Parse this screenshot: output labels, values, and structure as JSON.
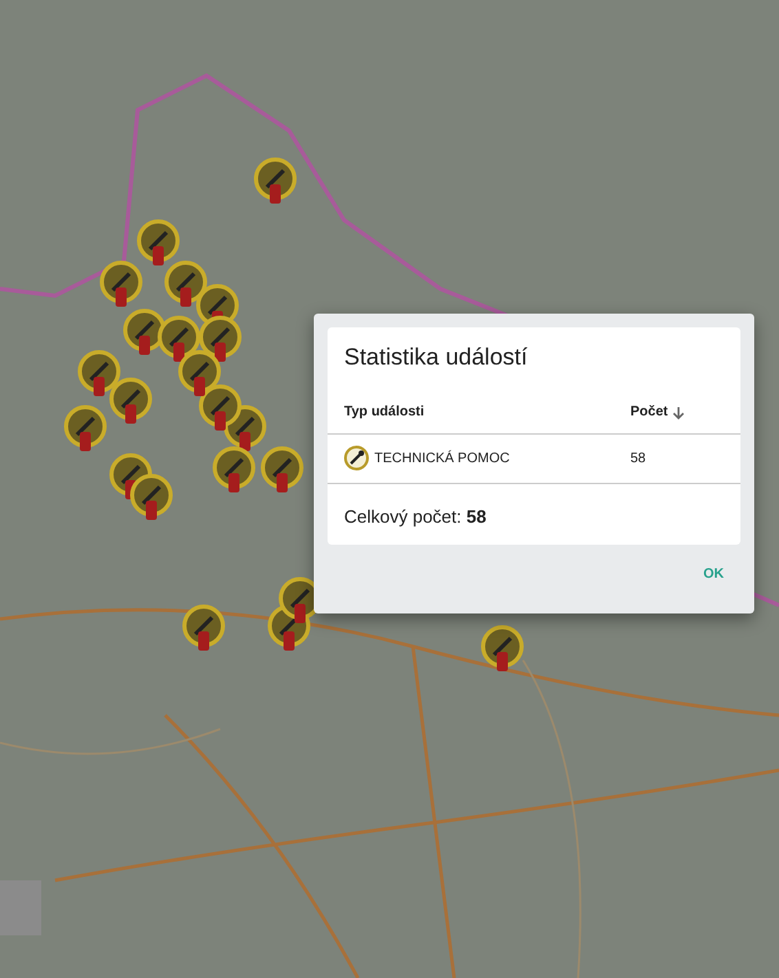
{
  "dialog": {
    "title": "Statistika událostí",
    "columns": [
      {
        "label": "Typ události",
        "sorted_descending": false
      },
      {
        "label": "Počet",
        "sorted_descending": true
      }
    ],
    "rows": [
      {
        "kind": "wrench",
        "type": "TECHNICKÁ POMOC",
        "count": "58"
      }
    ],
    "total": "Celkový počet: **58**",
    "button": "OK"
  }
}
